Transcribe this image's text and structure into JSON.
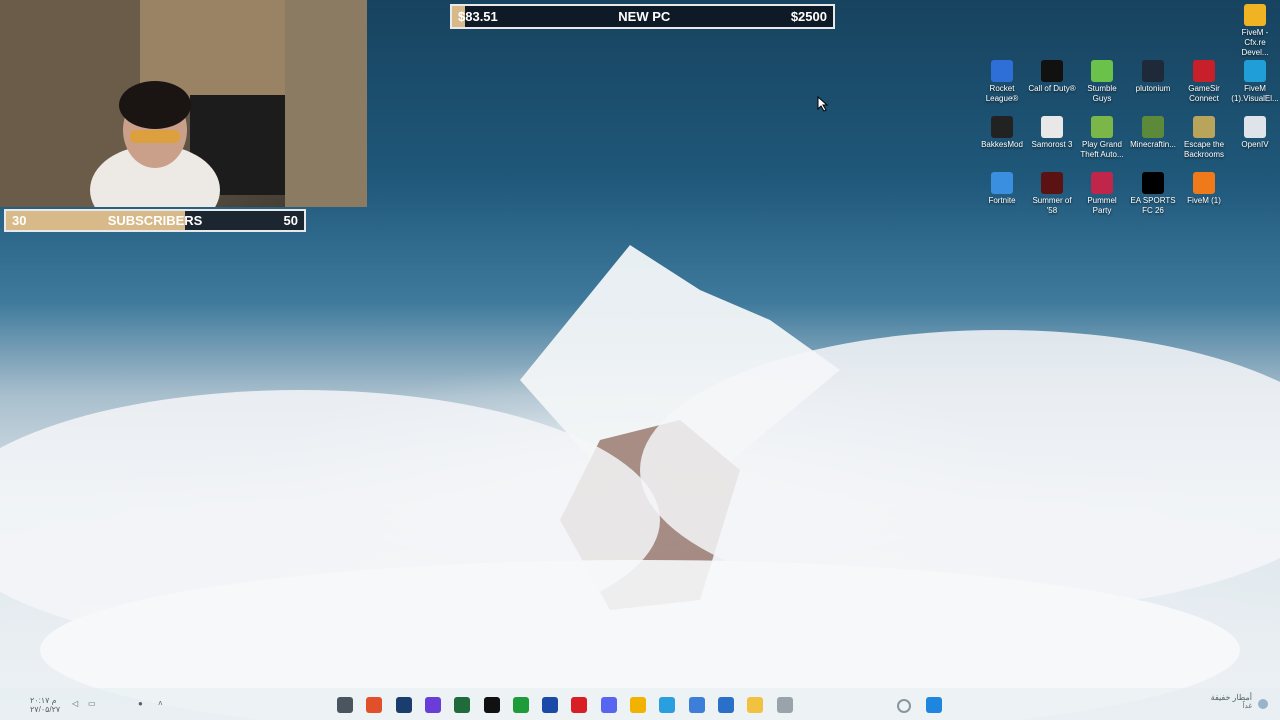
{
  "goal_bar": {
    "current": "$83.51",
    "title": "NEW PC",
    "target": "$2500",
    "progress": 0.033
  },
  "subscriber_bar": {
    "current": "30",
    "title": "SUBSCRIBERS",
    "target": "50",
    "progress": 0.6
  },
  "desktop_icons": [
    {
      "label": "FiveM - Cfx.re Devel...",
      "icon": "fivem-folder-icon",
      "color": "#f0b323"
    },
    {
      "label": "Rocket League®",
      "icon": "rocket-league-icon",
      "color": "#2d6fd6"
    },
    {
      "label": "Call of Duty®",
      "icon": "call-of-duty-icon",
      "color": "#111111"
    },
    {
      "label": "Stumble Guys",
      "icon": "stumble-guys-icon",
      "color": "#6ac24a"
    },
    {
      "label": "plutonium",
      "icon": "plutonium-icon",
      "color": "#1e2a3a"
    },
    {
      "label": "GameSir Connect",
      "icon": "gamesir-icon",
      "color": "#c8202a"
    },
    {
      "label": "FiveM (1).VisualEl...",
      "icon": "edge-icon",
      "color": "#1f9ed8"
    },
    {
      "label": "BakkesMod",
      "icon": "bakkesmod-icon",
      "color": "#222222"
    },
    {
      "label": "Samorost 3",
      "icon": "samorost-icon",
      "color": "#e8e8e8"
    },
    {
      "label": "Play Grand Theft Auto...",
      "icon": "gta-icon",
      "color": "#7ab648"
    },
    {
      "label": "Minecraftin...",
      "icon": "minecraft-icon",
      "color": "#5c8a3a"
    },
    {
      "label": "Escape the Backrooms",
      "icon": "escape-backrooms-icon",
      "color": "#b8a45a"
    },
    {
      "label": "OpenIV",
      "icon": "openiv-icon",
      "color": "#dfe4ea"
    },
    {
      "label": "Fortnite",
      "icon": "fortnite-icon",
      "color": "#3a8fe0"
    },
    {
      "label": "Summer of '58",
      "icon": "summer58-icon",
      "color": "#5a1212"
    },
    {
      "label": "Pummel Party",
      "icon": "pummel-party-icon",
      "color": "#c0264a"
    },
    {
      "label": "EA SPORTS FC 26",
      "icon": "ea-fc-icon",
      "color": "#000000"
    },
    {
      "label": "FiveM (1)",
      "icon": "fivem-icon",
      "color": "#f07a1a"
    }
  ],
  "taskbar": {
    "icons": [
      {
        "name": "app-icon",
        "color": "#4a5560"
      },
      {
        "name": "brave-icon",
        "color": "#e2502a"
      },
      {
        "name": "steam-icon",
        "color": "#1b3d6d"
      },
      {
        "name": "app-icon",
        "color": "#6a3cd8"
      },
      {
        "name": "excel-icon",
        "color": "#1f6b3c"
      },
      {
        "name": "app-icon",
        "color": "#111111"
      },
      {
        "name": "xbox-icon",
        "color": "#1f9c3a"
      },
      {
        "name": "photos-icon",
        "color": "#1a4aa8"
      },
      {
        "name": "netflix-icon",
        "color": "#d81f26"
      },
      {
        "name": "discord-icon",
        "color": "#5865f2"
      },
      {
        "name": "chrome-icon",
        "color": "#f2b300"
      },
      {
        "name": "telegram-icon",
        "color": "#2a9fe0"
      },
      {
        "name": "store-icon",
        "color": "#3d7fd8"
      },
      {
        "name": "app-icon",
        "color": "#2a6fc8"
      },
      {
        "name": "file-explorer-icon",
        "color": "#f0c240"
      },
      {
        "name": "app-icon",
        "color": "#9aa2aa"
      },
      {
        "name": "search-icon",
        "color": "#8a959f"
      },
      {
        "name": "start-icon",
        "color": "#1f86e0"
      }
    ],
    "tray_left_time": "۲۰:۱۷ م",
    "tray_left_date": "۲۷/۰۵/۲۷",
    "weather_text": "أمطار خفيفة",
    "weather_subtext": "غداً"
  }
}
